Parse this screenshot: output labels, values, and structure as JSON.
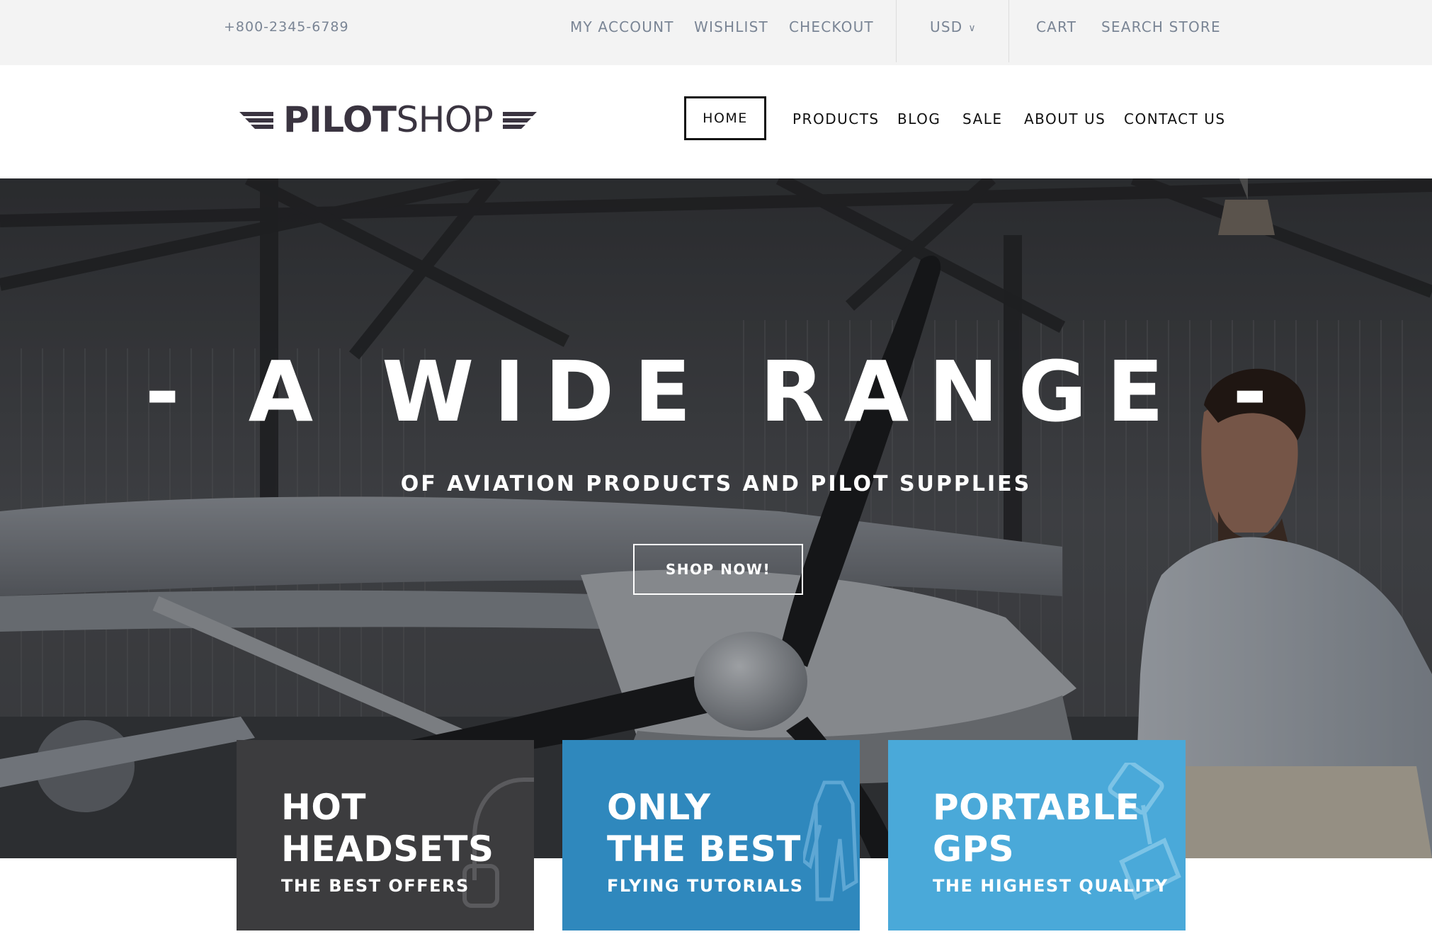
{
  "topbar": {
    "phone": "+800-2345-6789",
    "links": {
      "my_account": "MY ACCOUNT",
      "wishlist": "WISHLIST",
      "checkout": "CHECKOUT",
      "currency": "USD",
      "cart": "CART",
      "search": "SEARCH STORE"
    }
  },
  "header": {
    "logo": {
      "bold": "PILOT",
      "light": "SHOP"
    },
    "nav": {
      "home": "HOME",
      "products": "PRODUCTS",
      "blog": "BLOG",
      "sale": "SALE",
      "about": "ABOUT US",
      "contact": "CONTACT US"
    }
  },
  "hero": {
    "headline": "- A WIDE RANGE -",
    "subline": "OF AVIATION PRODUCTS AND PILOT SUPPLIES",
    "cta": "SHOP NOW!"
  },
  "cards": [
    {
      "title_line1": "HOT",
      "title_line2": "HEADSETS",
      "subtitle": "THE BEST OFFERS",
      "icon": "headset-icon",
      "color": "#3c3c3e"
    },
    {
      "title_line1": "ONLY",
      "title_line2": "THE BEST",
      "subtitle": "FLYING TUTORIALS",
      "icon": "flight-suit-icon",
      "color": "#2f88bd"
    },
    {
      "title_line1": "PORTABLE",
      "title_line2": "GPS",
      "subtitle": "THE HIGHEST QUALITY",
      "icon": "gps-device-icon",
      "color": "#4aa9d9"
    }
  ],
  "colors": {
    "topbar_bg": "#f3f3f3",
    "topbar_text": "#7a8595",
    "nav_text": "#111111"
  }
}
